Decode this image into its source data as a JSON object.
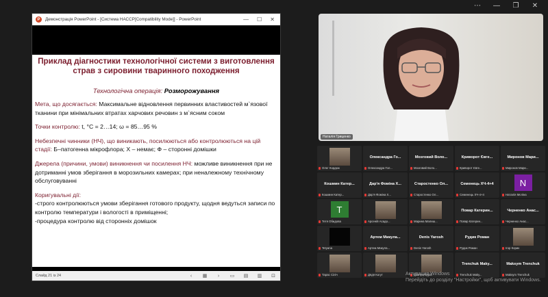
{
  "ppt": {
    "title": "Демонстрація PowerPoint - [Система НАССР[Compatibility Mode]] - PowerPoint",
    "status": "Слайд 21 із 24"
  },
  "slide": {
    "title_line1": "Приклад діагностики технологічної системи з виготовлення",
    "title_line2": "страв з сировини тваринного походження",
    "op_label": "Технологічна операція: ",
    "op_value": "Розморожування",
    "goal_h": "Мета, що досягається:",
    "goal_t": " Максимальне відновлення первинних властивостей м`язової тканини при мінімальних втратах харчових речовин з м`ясним соком",
    "cp_h": "Точки контролю:",
    "cp_t": " t, °С = 2…14; ω = 85…95 %",
    "haz_h": "Небезпечні чинники (НЧ), що виникають, посилюються або контролюються на цій стадії:",
    "haz_t": " Б–патогенна мікрофлора; Х – немає; Ф – сторонні домішки",
    "src_h": "Джерела (причини, умови) виникнення чи посилення НЧ:",
    "src_t": " можливе виникнення при не дотриманні умов зберігання в морозильних камерах; при неналежному технічному обслуговуванні",
    "corr_h": "Коригувальні дії:",
    "corr_1": "-строго контролюються умови зберігання готового продукту, щодня ведуться записи по контролю температури і вологості в приміщенні;",
    "corr_2": "-процедура контролю від сторонніх домішок"
  },
  "main_video": {
    "name": "Наталія Гриценко"
  },
  "tiles": [
    {
      "name": "",
      "label": "Олег Кордюк",
      "avatar": "photo"
    },
    {
      "name": "Олександра Го...",
      "label": "Олександра Гол...",
      "avatar": ""
    },
    {
      "name": "Мозговий Воло...",
      "label": "Мозговий Воло...",
      "avatar": ""
    },
    {
      "name": "Криворот Євге...",
      "label": "Криворот Євге...",
      "avatar": ""
    },
    {
      "name": "Миронов Мари...",
      "label": "Миронов Мари...",
      "avatar": ""
    },
    {
      "name": "Кошмин Катер...",
      "label": "Кошмин Катер...",
      "avatar": ""
    },
    {
      "name": "Дар'я Фоміна Х...",
      "label": "Дар'я Фоміна Х...",
      "avatar": ""
    },
    {
      "name": "Старостенко Ол...",
      "label": "Старостенко Ол...",
      "avatar": ""
    },
    {
      "name": "Семенець ХЧ-4+4",
      "label": "Семенець ХЧ-4+4",
      "avatar": ""
    },
    {
      "name": "",
      "label": "Наталія Мєліна",
      "avatar": "N"
    },
    {
      "name": "",
      "label": "Тетя Обидова",
      "avatar": "T"
    },
    {
      "name": "",
      "label": "Арсеній Асадо...",
      "avatar": "photo"
    },
    {
      "name": "",
      "label": "Марина Малиш...",
      "avatar": "photo"
    },
    {
      "name": "Повар Катерин...",
      "label": "Повар Катерин...",
      "avatar": ""
    },
    {
      "name": "Черненко Анас...",
      "label": "Черненко Анас...",
      "avatar": ""
    },
    {
      "name": "",
      "label": "Tetyana",
      "avatar": "dark"
    },
    {
      "name": "Артем Микула...",
      "label": "Артем Микула...",
      "avatar": ""
    },
    {
      "name": "Denis Yarosh",
      "label": "Denis Yarosh",
      "avatar": ""
    },
    {
      "name": "Рудик Роман",
      "label": "Рудик Роман",
      "avatar": ""
    },
    {
      "name": "",
      "label": "Ігор Корик",
      "avatar": "photo"
    },
    {
      "name": "",
      "label": "Тарас Сіліч",
      "avatar": "photo"
    },
    {
      "name": "",
      "label": "Дядя Когут",
      "avatar": "photo"
    },
    {
      "name": "",
      "label": "Дмитро Бурій",
      "avatar": "photo"
    },
    {
      "name": "Trenchuk Maky...",
      "label": "Trenchuk Maky...",
      "avatar": ""
    },
    {
      "name": "Maksym Trenchuk",
      "label": "Maksym Trenchuk",
      "avatar": ""
    }
  ],
  "watermark": {
    "line1": "Активация Windows",
    "line2": "Перейдіть до розділу \"Настройки\", щоб активувати Windows."
  }
}
